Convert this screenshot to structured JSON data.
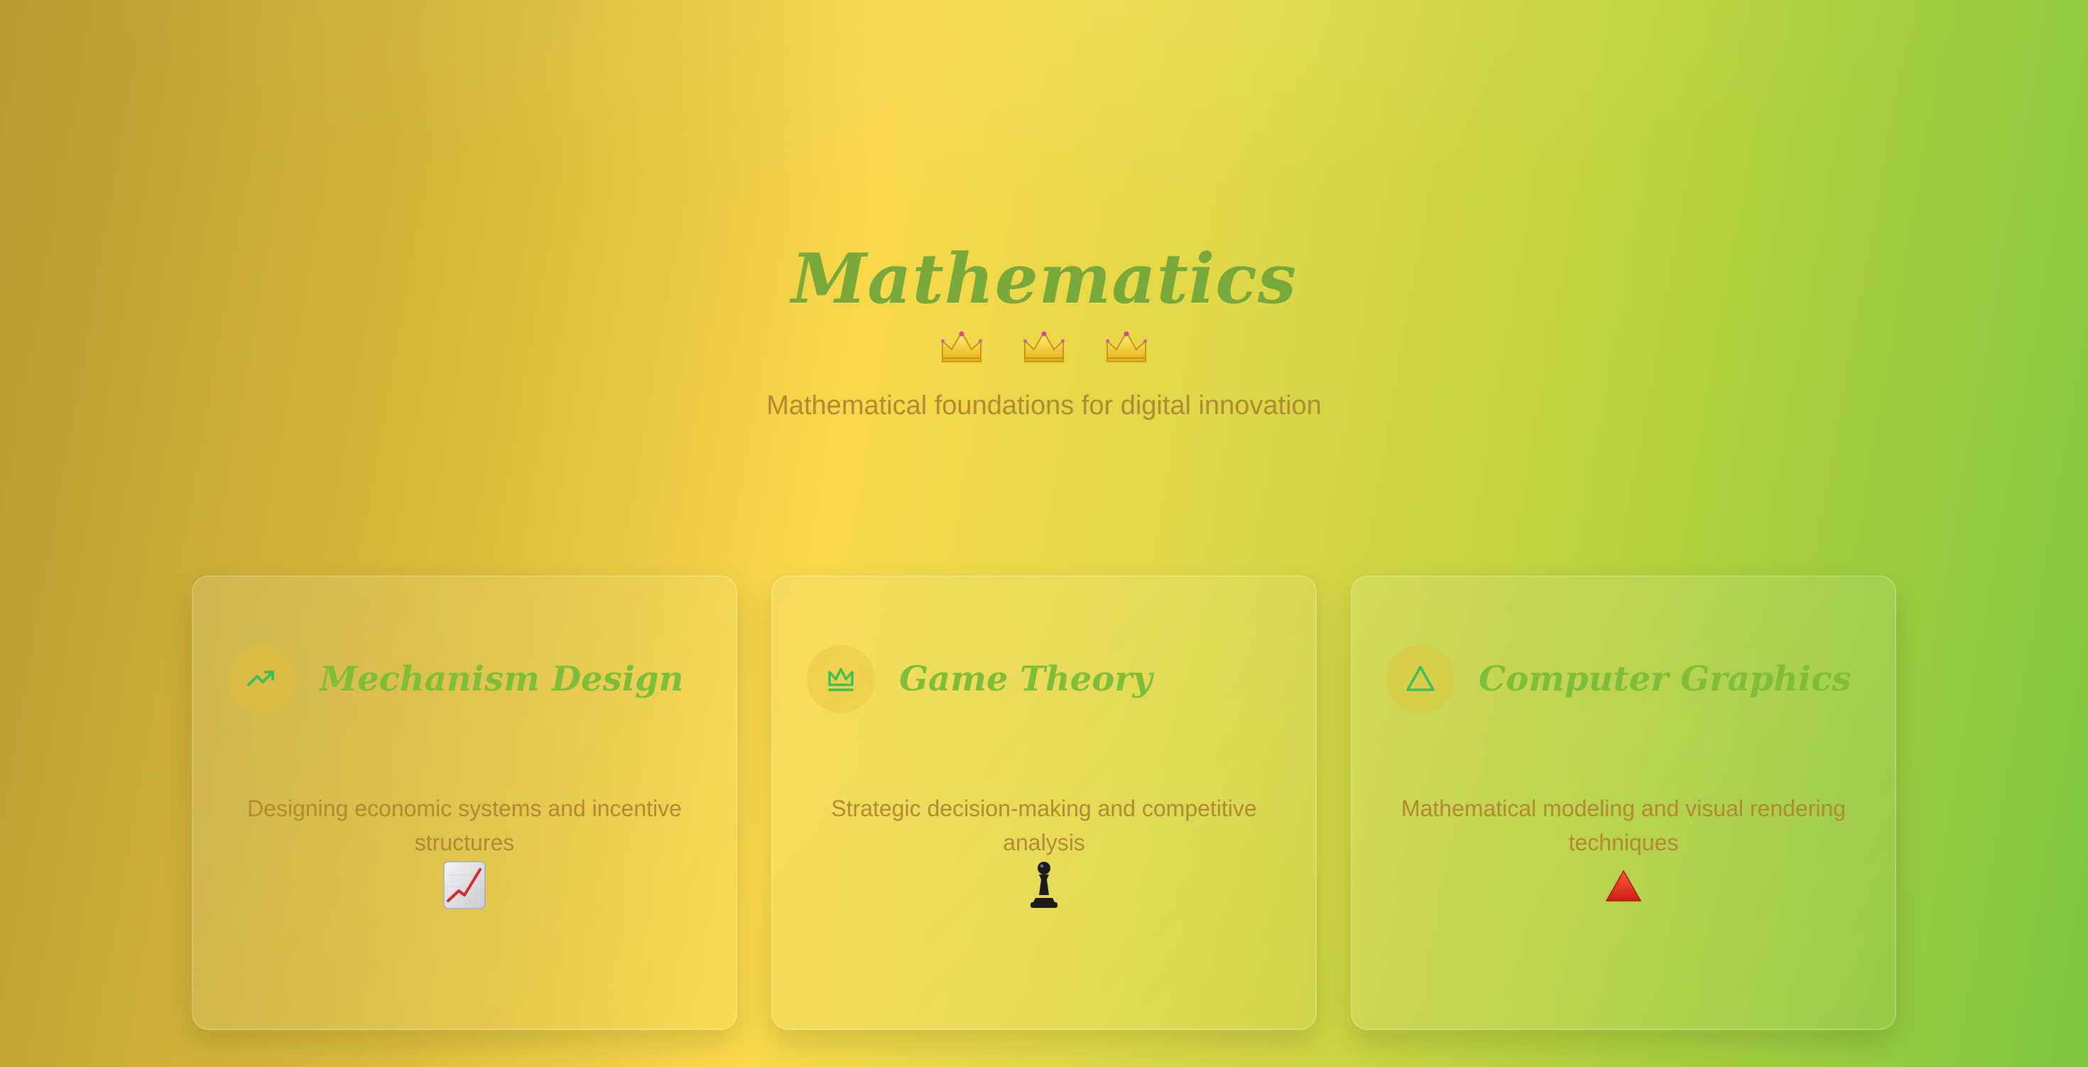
{
  "hero": {
    "title": "Mathematics",
    "subtitle": "Mathematical foundations for digital innovation",
    "decorations": [
      "crown-icon",
      "crown-icon",
      "crown-icon"
    ]
  },
  "cards": [
    {
      "title": "Mechanism Design",
      "description": "Designing economic systems and incentive structures",
      "icon": "trending-up-icon",
      "emoji": "chart-increasing-icon"
    },
    {
      "title": "Game Theory",
      "description": "Strategic decision-making and competitive analysis",
      "icon": "crown-outline-icon",
      "emoji": "chess-pawn-icon"
    },
    {
      "title": "Computer Graphics",
      "description": "Mathematical modeling and visual rendering techniques",
      "icon": "triangle-icon",
      "emoji": "red-triangle-icon"
    }
  ],
  "colors": {
    "title_green": "#79a93a",
    "card_title_green": "#7fbe3a",
    "text_brown": "#b08a35",
    "icon_green": "#3fbf5a",
    "emoji_red": "#e0301e"
  }
}
